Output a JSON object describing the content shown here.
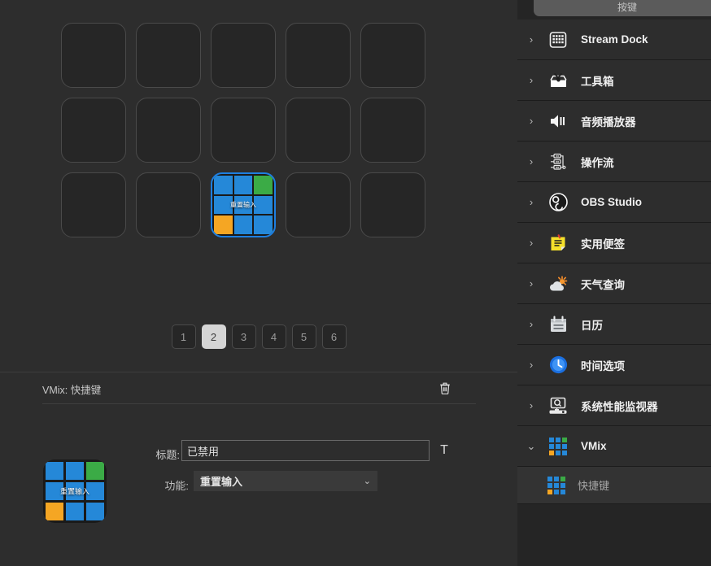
{
  "main": {
    "grid": {
      "rows": 3,
      "cols": 5,
      "filled_index": 12,
      "filled_tile": {
        "label": "重置输入",
        "icon_name": "vmix-grid-icon",
        "colors": [
          "#2588d8",
          "#3bab46",
          "#f5a623"
        ]
      }
    },
    "pagination": {
      "pages": [
        "1",
        "2",
        "3",
        "4",
        "5",
        "6"
      ],
      "active": "2"
    }
  },
  "editor": {
    "title": "VMix: 快捷键",
    "delete_icon": "trash-icon",
    "preview": {
      "label": "重置输入",
      "icon_name": "vmix-grid-icon"
    },
    "title_field": {
      "label": "标题:",
      "value": "已禁用",
      "placeholder": ""
    },
    "text_style_button": "T",
    "function_field": {
      "label": "功能:",
      "value": "重置输入",
      "chevron": "⌄"
    }
  },
  "sidebar": {
    "tab": {
      "label": "按键"
    },
    "items": [
      {
        "label": "Stream Dock",
        "icon": "stream-dock-grid-icon",
        "chevron": "›",
        "expanded": false
      },
      {
        "label": "工具箱",
        "icon": "toolbox-icon",
        "chevron": "›",
        "expanded": false
      },
      {
        "label": "音频播放器",
        "icon": "speaker-icon",
        "chevron": "›",
        "expanded": false
      },
      {
        "label": "操作流",
        "icon": "workflow-icon",
        "chevron": "›",
        "expanded": false
      },
      {
        "label": "OBS Studio",
        "icon": "obs-studio-icon",
        "chevron": "›",
        "expanded": false
      },
      {
        "label": "实用便签",
        "icon": "sticky-note-icon",
        "chevron": "›",
        "expanded": false
      },
      {
        "label": "天气查询",
        "icon": "weather-icon",
        "chevron": "›",
        "expanded": false
      },
      {
        "label": "日历",
        "icon": "calendar-icon",
        "chevron": "›",
        "expanded": false
      },
      {
        "label": "时间选项",
        "icon": "clock-icon",
        "chevron": "›",
        "expanded": false
      },
      {
        "label": "系统性能监视器",
        "icon": "system-monitor-icon",
        "chevron": "›",
        "expanded": false
      },
      {
        "label": "VMix",
        "icon": "vmix-grid-icon",
        "chevron": "⌄",
        "expanded": true
      }
    ],
    "subitems": [
      {
        "label": "快捷键",
        "icon": "vmix-grid-icon",
        "parent": "VMix",
        "selected": true
      }
    ]
  },
  "colors": {
    "accent_blue": "#2588d8",
    "accent_green": "#3bab46",
    "accent_orange": "#f5a623",
    "selection_border": "#1e7fe0",
    "page_active_bg": "#d5d5d5",
    "panel_bg": "#2d2d2d",
    "sidebar_bg": "#252525"
  }
}
